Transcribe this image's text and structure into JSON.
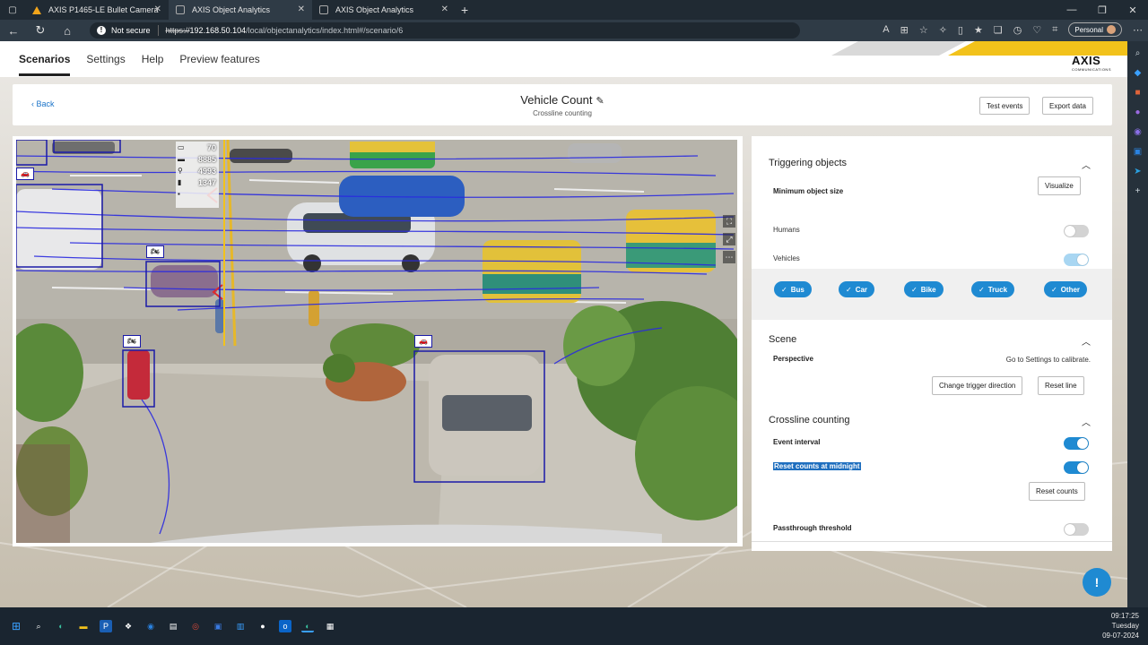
{
  "browser": {
    "tabs": [
      {
        "title": "AXIS P1465-LE Bullet Camera",
        "active": false
      },
      {
        "title": "AXIS Object Analytics",
        "active": true
      },
      {
        "title": "AXIS Object Analytics",
        "active": false
      }
    ],
    "security_label": "Not secure",
    "url_scheme": "https://",
    "url_host": "192.168.50.104",
    "url_path": "/local/objectanalytics/index.html#/scenario/6",
    "profile_label": "Personal"
  },
  "app": {
    "nav": [
      "Scenarios",
      "Settings",
      "Help",
      "Preview features"
    ],
    "active_nav": "Scenarios",
    "logo_text": "AXIS",
    "logo_sub": "COMMUNICATIONS"
  },
  "header": {
    "back_label": "Back",
    "title": "Vehicle Count",
    "subtitle": "Crossline counting",
    "test_events_label": "Test events",
    "export_data_label": "Export data"
  },
  "video": {
    "counters": [
      "70",
      "8885",
      "4993",
      "1347"
    ]
  },
  "settings": {
    "triggering": {
      "title": "Triggering objects",
      "min_size_label": "Minimum object size",
      "visualize_label": "Visualize",
      "humans_label": "Humans",
      "humans_on": false,
      "vehicles_label": "Vehicles",
      "vehicles_on": true,
      "chips": [
        "Bus",
        "Car",
        "Bike",
        "Truck",
        "Other"
      ]
    },
    "scene": {
      "title": "Scene",
      "perspective_label": "Perspective",
      "perspective_hint": "Go to Settings to calibrate.",
      "change_direction_label": "Change trigger direction",
      "reset_line_label": "Reset line"
    },
    "crossline": {
      "title": "Crossline counting",
      "event_interval_label": "Event interval",
      "event_interval_on": true,
      "reset_midnight_label": "Reset counts at midnight",
      "reset_midnight_on": true,
      "reset_counts_label": "Reset counts",
      "passthrough_label": "Passthrough threshold",
      "passthrough_on": false
    }
  },
  "taskbar": {
    "time": "09:17:25",
    "day": "Tuesday",
    "date": "09-07-2024"
  },
  "colors": {
    "accent": "#1f8ad2",
    "detection_box": "#1a1aa8",
    "axis_yellow": "#f2c21b"
  }
}
